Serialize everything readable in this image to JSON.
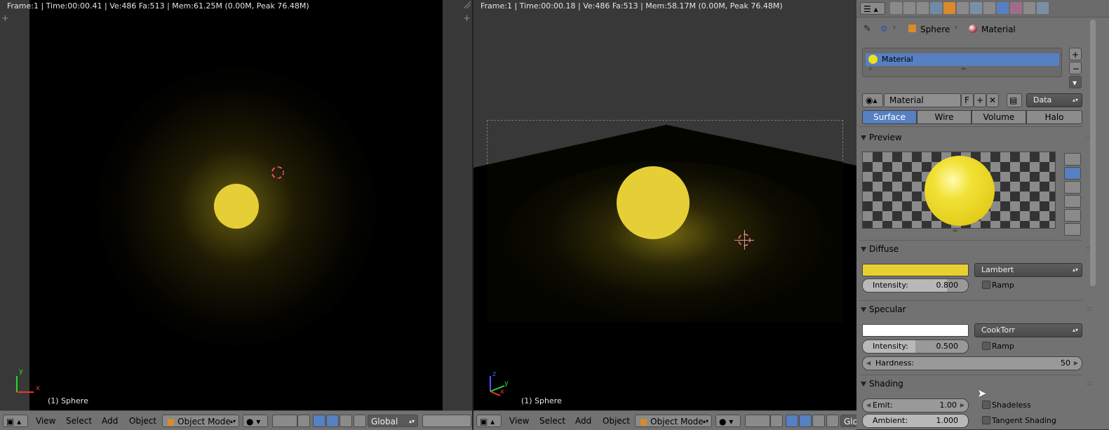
{
  "left_view": {
    "info": "Frame:1 | Time:00:00.41 | Ve:486 Fa:513 | Mem:61.25M (0.00M, Peak 76.48M)",
    "object_label": "(1) Sphere"
  },
  "right_view": {
    "info": "Frame:1 | Time:00:00.18 | Ve:486 Fa:513 | Mem:58.17M (0.00M, Peak 76.48M)",
    "object_label": "(1) Sphere"
  },
  "header_left": {
    "menus": [
      "View",
      "Select",
      "Add",
      "Object"
    ],
    "mode": "Object Mode",
    "orientation": "Global"
  },
  "header_right": {
    "menus": [
      "View",
      "Select",
      "Add",
      "Object"
    ],
    "mode": "Object Mode",
    "orientation": "Glo"
  },
  "axis_labels": {
    "x": "x",
    "y": "y",
    "z": "z"
  },
  "properties": {
    "breadcrumb": {
      "object": "Sphere",
      "material": "Material"
    },
    "material_slot": "Material",
    "material_name": "Material",
    "fake_user": "F",
    "link": "Data",
    "tabs": [
      "Surface",
      "Wire",
      "Volume",
      "Halo"
    ],
    "active_tab": "Surface",
    "preview": {
      "title": "Preview"
    },
    "diffuse": {
      "title": "Diffuse",
      "color": "#e8d032",
      "shader": "Lambert",
      "intensity_label": "Intensity:",
      "intensity": "0.800",
      "intensity_fraction": 0.8,
      "ramp": "Ramp"
    },
    "specular": {
      "title": "Specular",
      "color": "#ffffff",
      "shader": "CookTorr",
      "intensity_label": "Intensity:",
      "intensity": "0.500",
      "intensity_fraction": 0.5,
      "ramp": "Ramp",
      "hardness_label": "Hardness:",
      "hardness": "50"
    },
    "shading": {
      "title": "Shading",
      "emit_label": "Emit:",
      "emit": "1.00",
      "ambient_label": "Ambient:",
      "ambient": "1.000",
      "shadeless": "Shadeless",
      "tangent_shading": "Tangent Shading"
    }
  },
  "colors": {
    "accent": "#5680c2",
    "sphere": "#e8d032"
  }
}
